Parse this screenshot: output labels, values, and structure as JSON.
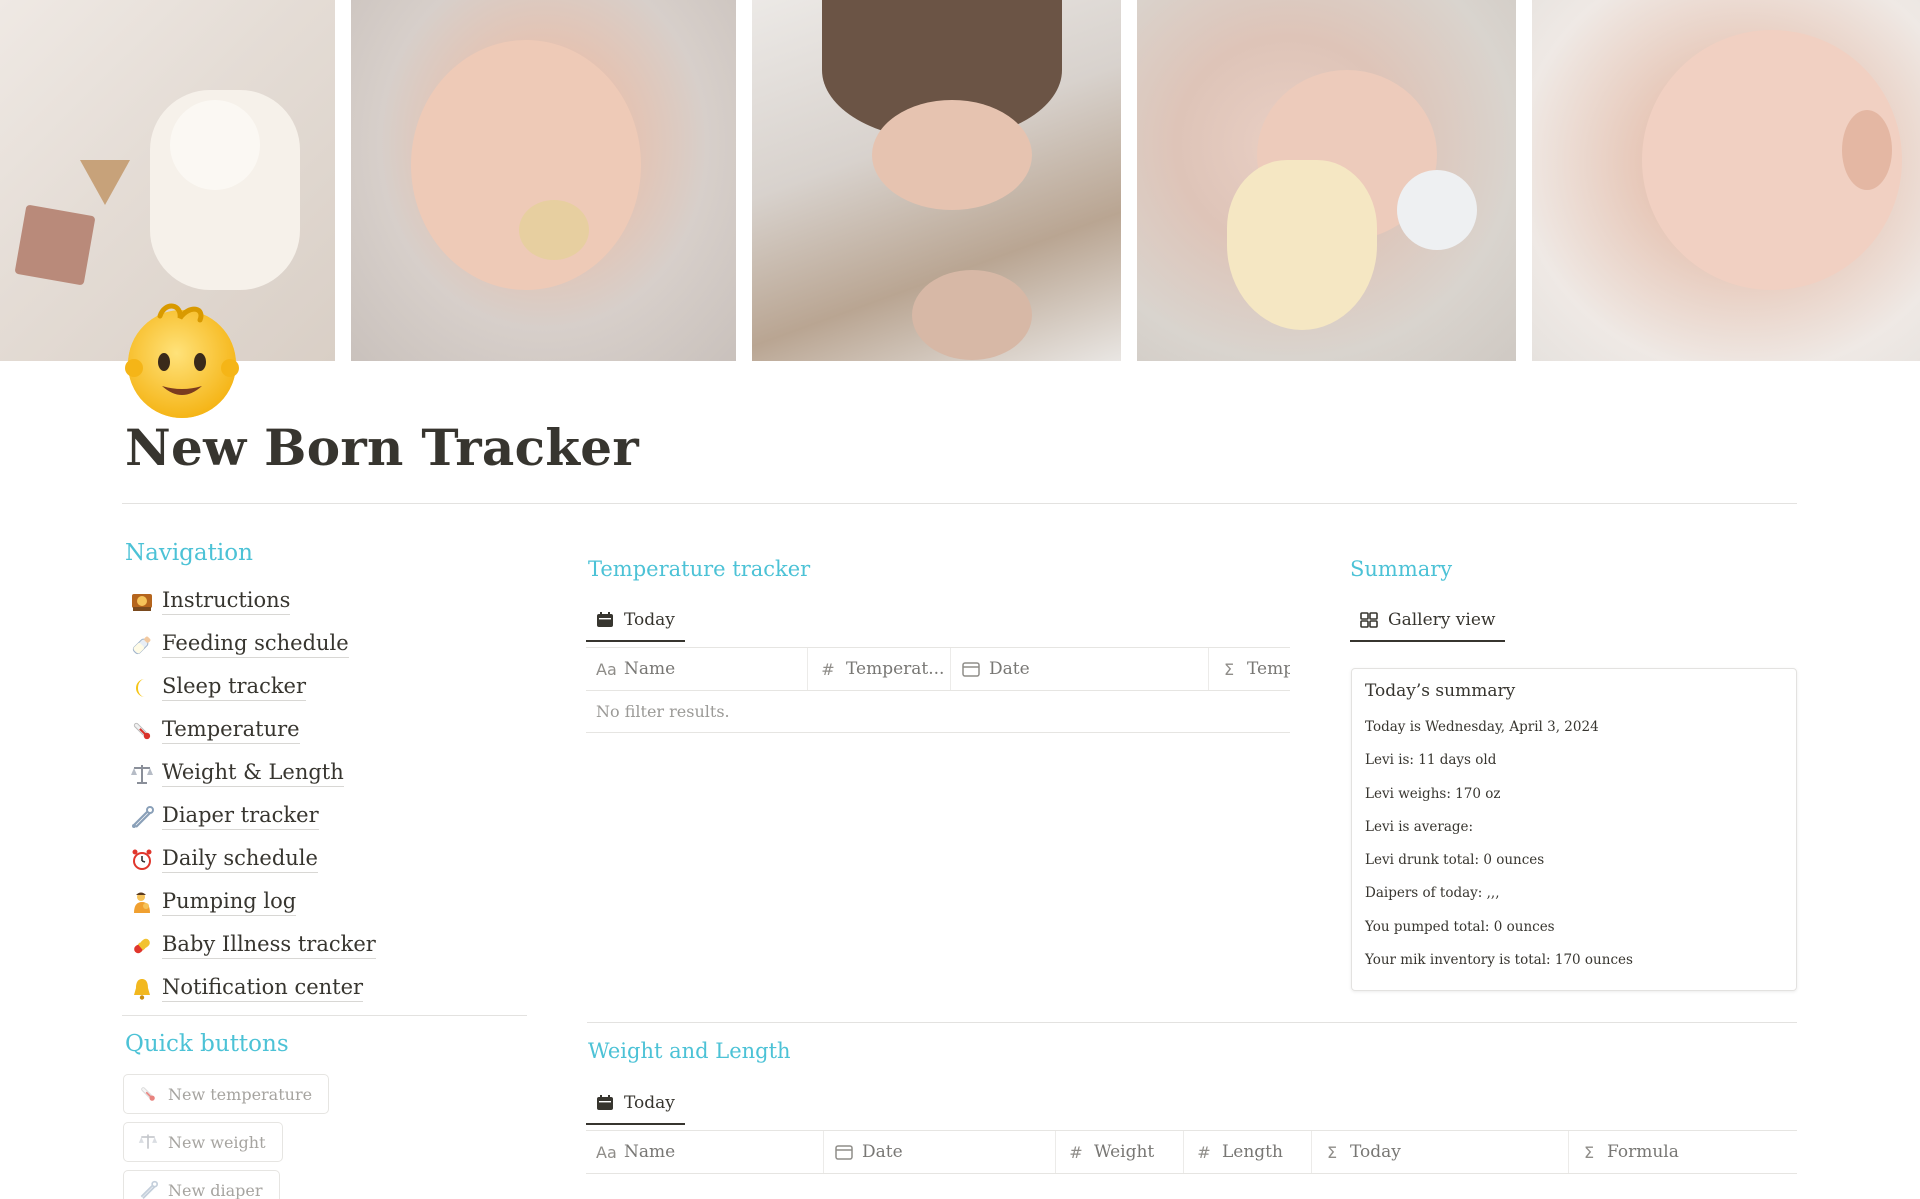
{
  "page": {
    "title": "New Born Tracker",
    "icon": "baby-emoji-icon"
  },
  "cover": {
    "photos": [
      "plush-bunny-photo",
      "baby-pacifier-photo",
      "mother-and-baby-photo",
      "bottle-feeding-photo",
      "breastfeeding-photo"
    ]
  },
  "navigation": {
    "heading": "Navigation",
    "items": [
      {
        "label": "Instructions",
        "icon": "teacher-icon"
      },
      {
        "label": "Feeding schedule",
        "icon": "baby-bottle-icon"
      },
      {
        "label": "Sleep tracker",
        "icon": "crescent-moon-icon"
      },
      {
        "label": "Temperature",
        "icon": "thermometer-icon"
      },
      {
        "label": "Weight & Length",
        "icon": "balance-scale-icon"
      },
      {
        "label": "Diaper tracker",
        "icon": "safety-pin-icon"
      },
      {
        "label": "Daily schedule",
        "icon": "alarm-clock-icon"
      },
      {
        "label": "Pumping log",
        "icon": "nursing-person-icon"
      },
      {
        "label": "Baby Illness tracker",
        "icon": "pill-icon"
      },
      {
        "label": "Notification center",
        "icon": "bell-icon"
      }
    ]
  },
  "quick_buttons": {
    "heading": "Quick buttons",
    "buttons": [
      {
        "label": "New temperature",
        "icon": "thermometer-icon"
      },
      {
        "label": "New weight",
        "icon": "balance-scale-icon"
      },
      {
        "label": "New diaper",
        "icon": "safety-pin-icon"
      }
    ]
  },
  "temperature_tracker": {
    "heading": "Temperature tracker",
    "view_tab": "Today",
    "columns": [
      {
        "label": "Name",
        "type_icon": "Aa"
      },
      {
        "label": "Temperat...",
        "type_icon": "#"
      },
      {
        "label": "Date",
        "type_icon": "calendar"
      },
      {
        "label": "Temp",
        "type_icon": "Σ"
      }
    ],
    "empty_text": "No filter results."
  },
  "summary": {
    "heading": "Summary",
    "view_tab": "Gallery view",
    "card": {
      "title": "Today’s summary",
      "lines": [
        "Today is Wednesday, April 3, 2024",
        "Levi is: 11 days old",
        "Levi weighs: 170 oz",
        "Levi is average:",
        "Levi drunk total: 0 ounces",
        "Daipers of today: ,,,",
        "You pumped total: 0 ounces",
        "Your mik inventory is total: 170 ounces"
      ]
    }
  },
  "weight_length": {
    "heading": "Weight and Length",
    "view_tab": "Today",
    "columns": [
      {
        "label": "Name",
        "type_icon": "Aa"
      },
      {
        "label": "Date",
        "type_icon": "calendar"
      },
      {
        "label": "Weight",
        "type_icon": "#"
      },
      {
        "label": "Length",
        "type_icon": "#"
      },
      {
        "label": "Today",
        "type_icon": "Σ"
      },
      {
        "label": "Formula",
        "type_icon": "Σ"
      }
    ]
  },
  "colors": {
    "heading_accent": "#4cc2d6",
    "text": "#37352f",
    "muted": "#9b9a97"
  }
}
